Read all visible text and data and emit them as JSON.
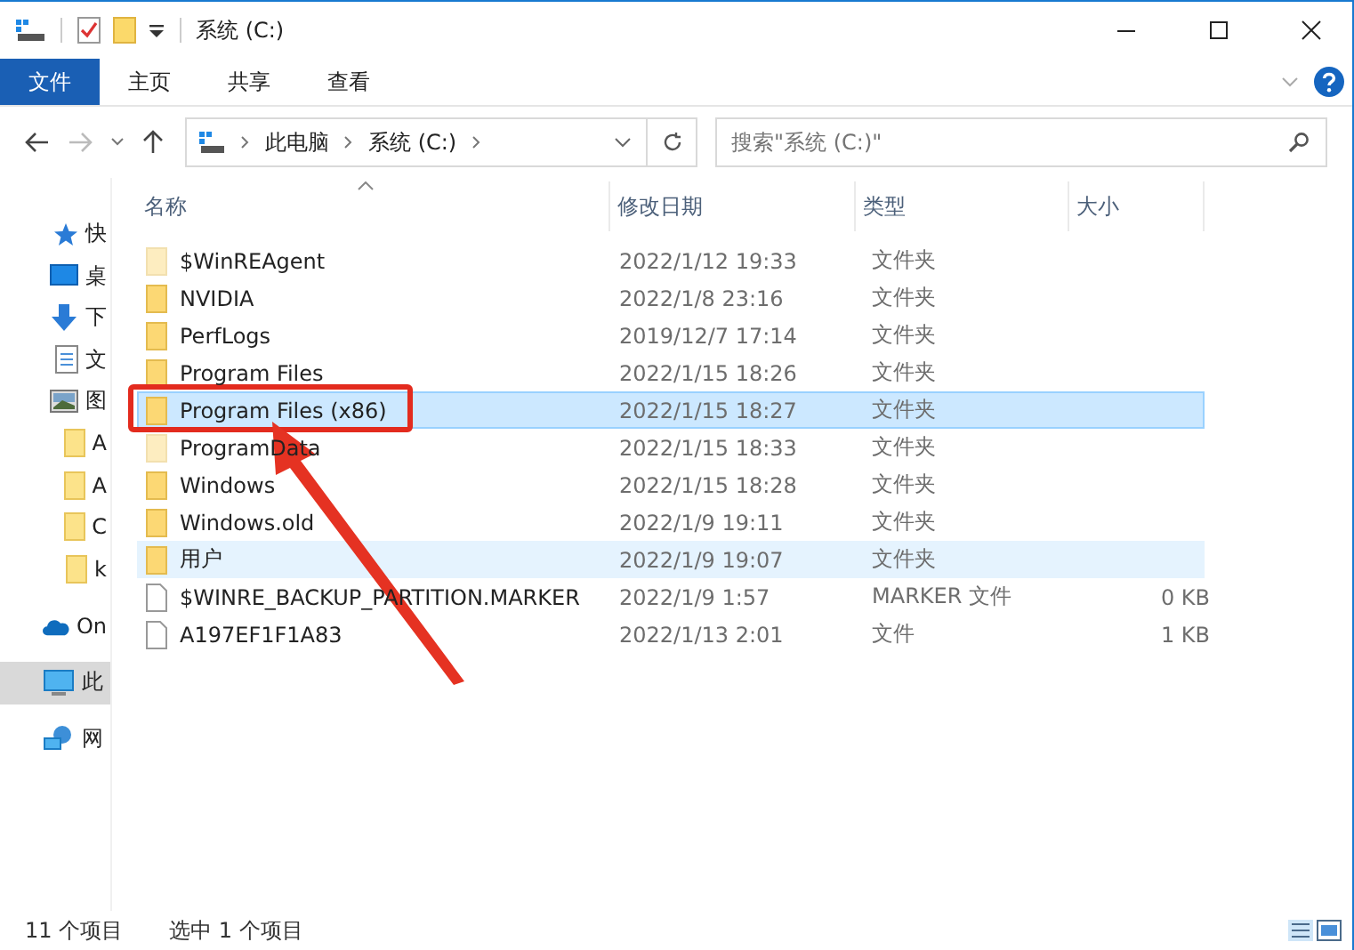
{
  "window": {
    "title": "系统 (C:)"
  },
  "ribbon_tabs": [
    {
      "label": "文件",
      "selected": true
    },
    {
      "label": "主页",
      "selected": false
    },
    {
      "label": "共享",
      "selected": false
    },
    {
      "label": "查看",
      "selected": false
    }
  ],
  "address": {
    "crumbs": [
      "此电脑",
      "系统 (C:)"
    ]
  },
  "search": {
    "placeholder": "搜索\"系统 (C:)\""
  },
  "sidebar": {
    "items": [
      {
        "label": "快",
        "kind": "star",
        "selected": false
      },
      {
        "label": "桌",
        "kind": "desktop",
        "selected": false
      },
      {
        "label": "下",
        "kind": "download",
        "selected": false
      },
      {
        "label": "文",
        "kind": "document",
        "selected": false
      },
      {
        "label": "图",
        "kind": "image",
        "selected": false
      },
      {
        "label": "A",
        "kind": "folder",
        "selected": false
      },
      {
        "label": "A",
        "kind": "folder",
        "selected": false
      },
      {
        "label": "C",
        "kind": "folder",
        "selected": false
      },
      {
        "label": "k",
        "kind": "folder",
        "selected": false
      },
      {
        "label": "On",
        "kind": "cloud",
        "selected": false
      },
      {
        "label": "此",
        "kind": "pc",
        "selected": true
      },
      {
        "label": "网",
        "kind": "network",
        "selected": false
      }
    ]
  },
  "table": {
    "columns": [
      "名称",
      "修改日期",
      "类型",
      "大小"
    ],
    "rows": [
      {
        "name": "$WinREAgent",
        "date": "2022/1/12 19:33",
        "type": "文件夹",
        "kind": "folder",
        "hidden": true,
        "selected": false,
        "hovered": false
      },
      {
        "name": "NVIDIA",
        "date": "2022/1/8 23:16",
        "type": "文件夹",
        "kind": "folder",
        "hidden": false,
        "selected": false,
        "hovered": false
      },
      {
        "name": "PerfLogs",
        "date": "2019/12/7 17:14",
        "type": "文件夹",
        "kind": "folder",
        "hidden": false,
        "selected": false,
        "hovered": false
      },
      {
        "name": "Program Files",
        "date": "2022/1/15 18:26",
        "type": "文件夹",
        "kind": "folder",
        "hidden": false,
        "selected": false,
        "hovered": false
      },
      {
        "name": "Program Files (x86)",
        "date": "2022/1/15 18:27",
        "type": "文件夹",
        "kind": "folder",
        "hidden": false,
        "selected": true,
        "hovered": false,
        "annotated": true
      },
      {
        "name": "ProgramData",
        "date": "2022/1/15 18:33",
        "type": "文件夹",
        "kind": "folder",
        "hidden": true,
        "selected": false,
        "hovered": false
      },
      {
        "name": "Windows",
        "date": "2022/1/15 18:28",
        "type": "文件夹",
        "kind": "folder",
        "hidden": false,
        "selected": false,
        "hovered": false
      },
      {
        "name": "Windows.old",
        "date": "2022/1/9 19:11",
        "type": "文件夹",
        "kind": "folder",
        "hidden": false,
        "selected": false,
        "hovered": false
      },
      {
        "name": "用户",
        "date": "2022/1/9 19:07",
        "type": "文件夹",
        "kind": "folder",
        "hidden": false,
        "selected": false,
        "hovered": true
      },
      {
        "name": "$WINRE_BACKUP_PARTITION.MARKER",
        "date": "2022/1/9 1:57",
        "type": "MARKER 文件",
        "size": "0 KB",
        "kind": "file",
        "hidden": false,
        "selected": false,
        "hovered": false
      },
      {
        "name": "A197EF1F1A83",
        "date": "2022/1/13 2:01",
        "type": "文件",
        "size": "1 KB",
        "kind": "file",
        "hidden": false,
        "selected": false,
        "hovered": false
      }
    ]
  },
  "status_bar": {
    "count": "11 个项目",
    "selection": "选中 1 个项目"
  }
}
